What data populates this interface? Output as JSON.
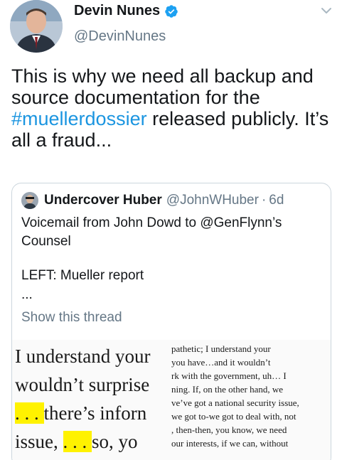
{
  "tweet": {
    "display_name": "Devin Nunes",
    "handle": "@DevinNunes",
    "verified_icon": "verified-badge-icon",
    "menu_icon": "chevron-down-icon",
    "text_before": "This is why we need all backup and source documentation for the ",
    "hashtag": "#muellerdossier",
    "text_after": " released publicly. It’s all a fraud..."
  },
  "quoted_tweet": {
    "display_name": "Undercover Huber",
    "handle": "@JohnWHuber",
    "separator": "·",
    "time": "6d",
    "line1": "Voicemail from John Dowd to @GenFlynn’s Counsel",
    "line2": "LEFT: Mueller report",
    "ellipsis": "...",
    "show_thread": "Show this thread"
  },
  "document_image": {
    "big_lines": [
      {
        "prefix": "",
        "highlight": "",
        "text": "I understand your"
      },
      {
        "prefix": "",
        "highlight": "",
        "text": "wouldn’t surprise"
      },
      {
        "prefix": "",
        "highlight": ". . . ",
        "text": "there’s inforn"
      },
      {
        "prefix": "issue, ",
        "highlight": ". . . ",
        "text": "so, yo"
      }
    ],
    "small_lines": [
      "pathetic; I understand your",
      "you have…and it wouldn’t",
      "rk with the government, uh… I",
      "ning. If, on the other hand, we",
      "ve’ve got a national security issue,",
      "we got to-we got to deal with, not",
      ", then-then, you know, we need",
      "our interests, if we can, without"
    ],
    "highlight_color": "#fff200"
  }
}
